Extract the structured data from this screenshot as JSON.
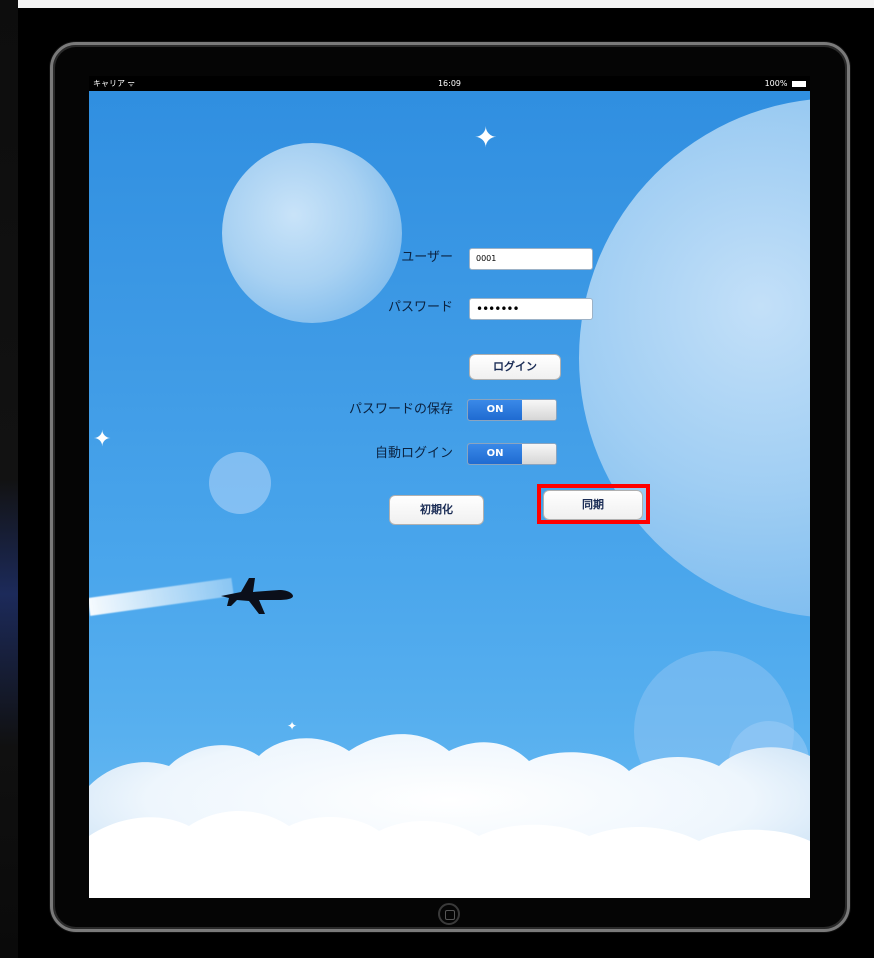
{
  "statusbar": {
    "carrier": "キャリア",
    "time": "16:09",
    "battery": "100%"
  },
  "login_form": {
    "user_label": "ユーザー",
    "user_value": "0001",
    "password_label": "パスワード",
    "password_value": "•••••••",
    "login_button": "ログイン"
  },
  "settings": {
    "save_password_label": "パスワードの保存",
    "save_password_state": "ON",
    "auto_login_label": "自動ログイン",
    "auto_login_state": "ON"
  },
  "actions": {
    "initialize_button": "初期化",
    "sync_button": "同期"
  },
  "colors": {
    "highlight": "#ff0000",
    "toggle_on": "#1f6bd1",
    "sky": "#3f9be6"
  },
  "icons": {
    "wifi": "wifi-icon",
    "battery": "battery-icon",
    "airplane": "airplane-icon",
    "home": "home-button-icon"
  }
}
